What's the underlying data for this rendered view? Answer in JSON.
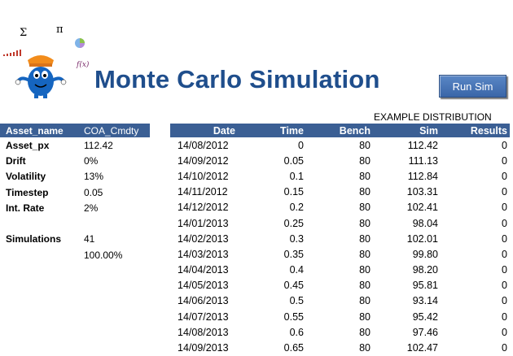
{
  "title": "Monte Carlo Simulation",
  "run_button": "Run Sim",
  "distribution_label": "EXAMPLE DISTRIBUTION",
  "params": {
    "header": {
      "name": "Asset_name",
      "value": "COA_Cmdty"
    },
    "rows": [
      {
        "name": "Asset_px",
        "value": "112.42"
      },
      {
        "name": "Drift",
        "value": "0%"
      },
      {
        "name": "Volatility",
        "value": "13%"
      },
      {
        "name": "Timestep",
        "value": "0.05"
      },
      {
        "name": "Int. Rate",
        "value": "2%"
      },
      {
        "name": "",
        "value": ""
      },
      {
        "name": "Simulations",
        "value": "41"
      },
      {
        "name": "",
        "value": "100.00%"
      }
    ]
  },
  "table": {
    "columns": [
      "Date",
      "Time",
      "Bench",
      "Sim",
      "Results"
    ],
    "rows": [
      [
        "14/08/2012",
        "0",
        "80",
        "112.42",
        "0"
      ],
      [
        "14/09/2012",
        "0.05",
        "80",
        "111.13",
        "0"
      ],
      [
        "14/10/2012",
        "0.1",
        "80",
        "112.84",
        "0"
      ],
      [
        "14/11/2012",
        "0.15",
        "80",
        "103.31",
        "0"
      ],
      [
        "14/12/2012",
        "0.2",
        "80",
        "102.41",
        "0"
      ],
      [
        "14/01/2013",
        "0.25",
        "80",
        "98.04",
        "0"
      ],
      [
        "14/02/2013",
        "0.3",
        "80",
        "102.01",
        "0"
      ],
      [
        "14/03/2013",
        "0.35",
        "80",
        "99.80",
        "0"
      ],
      [
        "14/04/2013",
        "0.4",
        "80",
        "98.20",
        "0"
      ],
      [
        "14/05/2013",
        "0.45",
        "80",
        "95.81",
        "0"
      ],
      [
        "14/06/2013",
        "0.5",
        "80",
        "93.14",
        "0"
      ],
      [
        "14/07/2013",
        "0.55",
        "80",
        "95.42",
        "0"
      ],
      [
        "14/08/2013",
        "0.6",
        "80",
        "97.46",
        "0"
      ],
      [
        "14/09/2013",
        "0.65",
        "80",
        "102.47",
        "0"
      ]
    ]
  },
  "logo": {
    "symbols": [
      "Σ",
      "π",
      "f(x)"
    ],
    "icon": "blue-mascot-icon",
    "colors": {
      "mascot": "#1565c0",
      "hat": "#f28c1b",
      "bars": "#c0392b"
    }
  }
}
